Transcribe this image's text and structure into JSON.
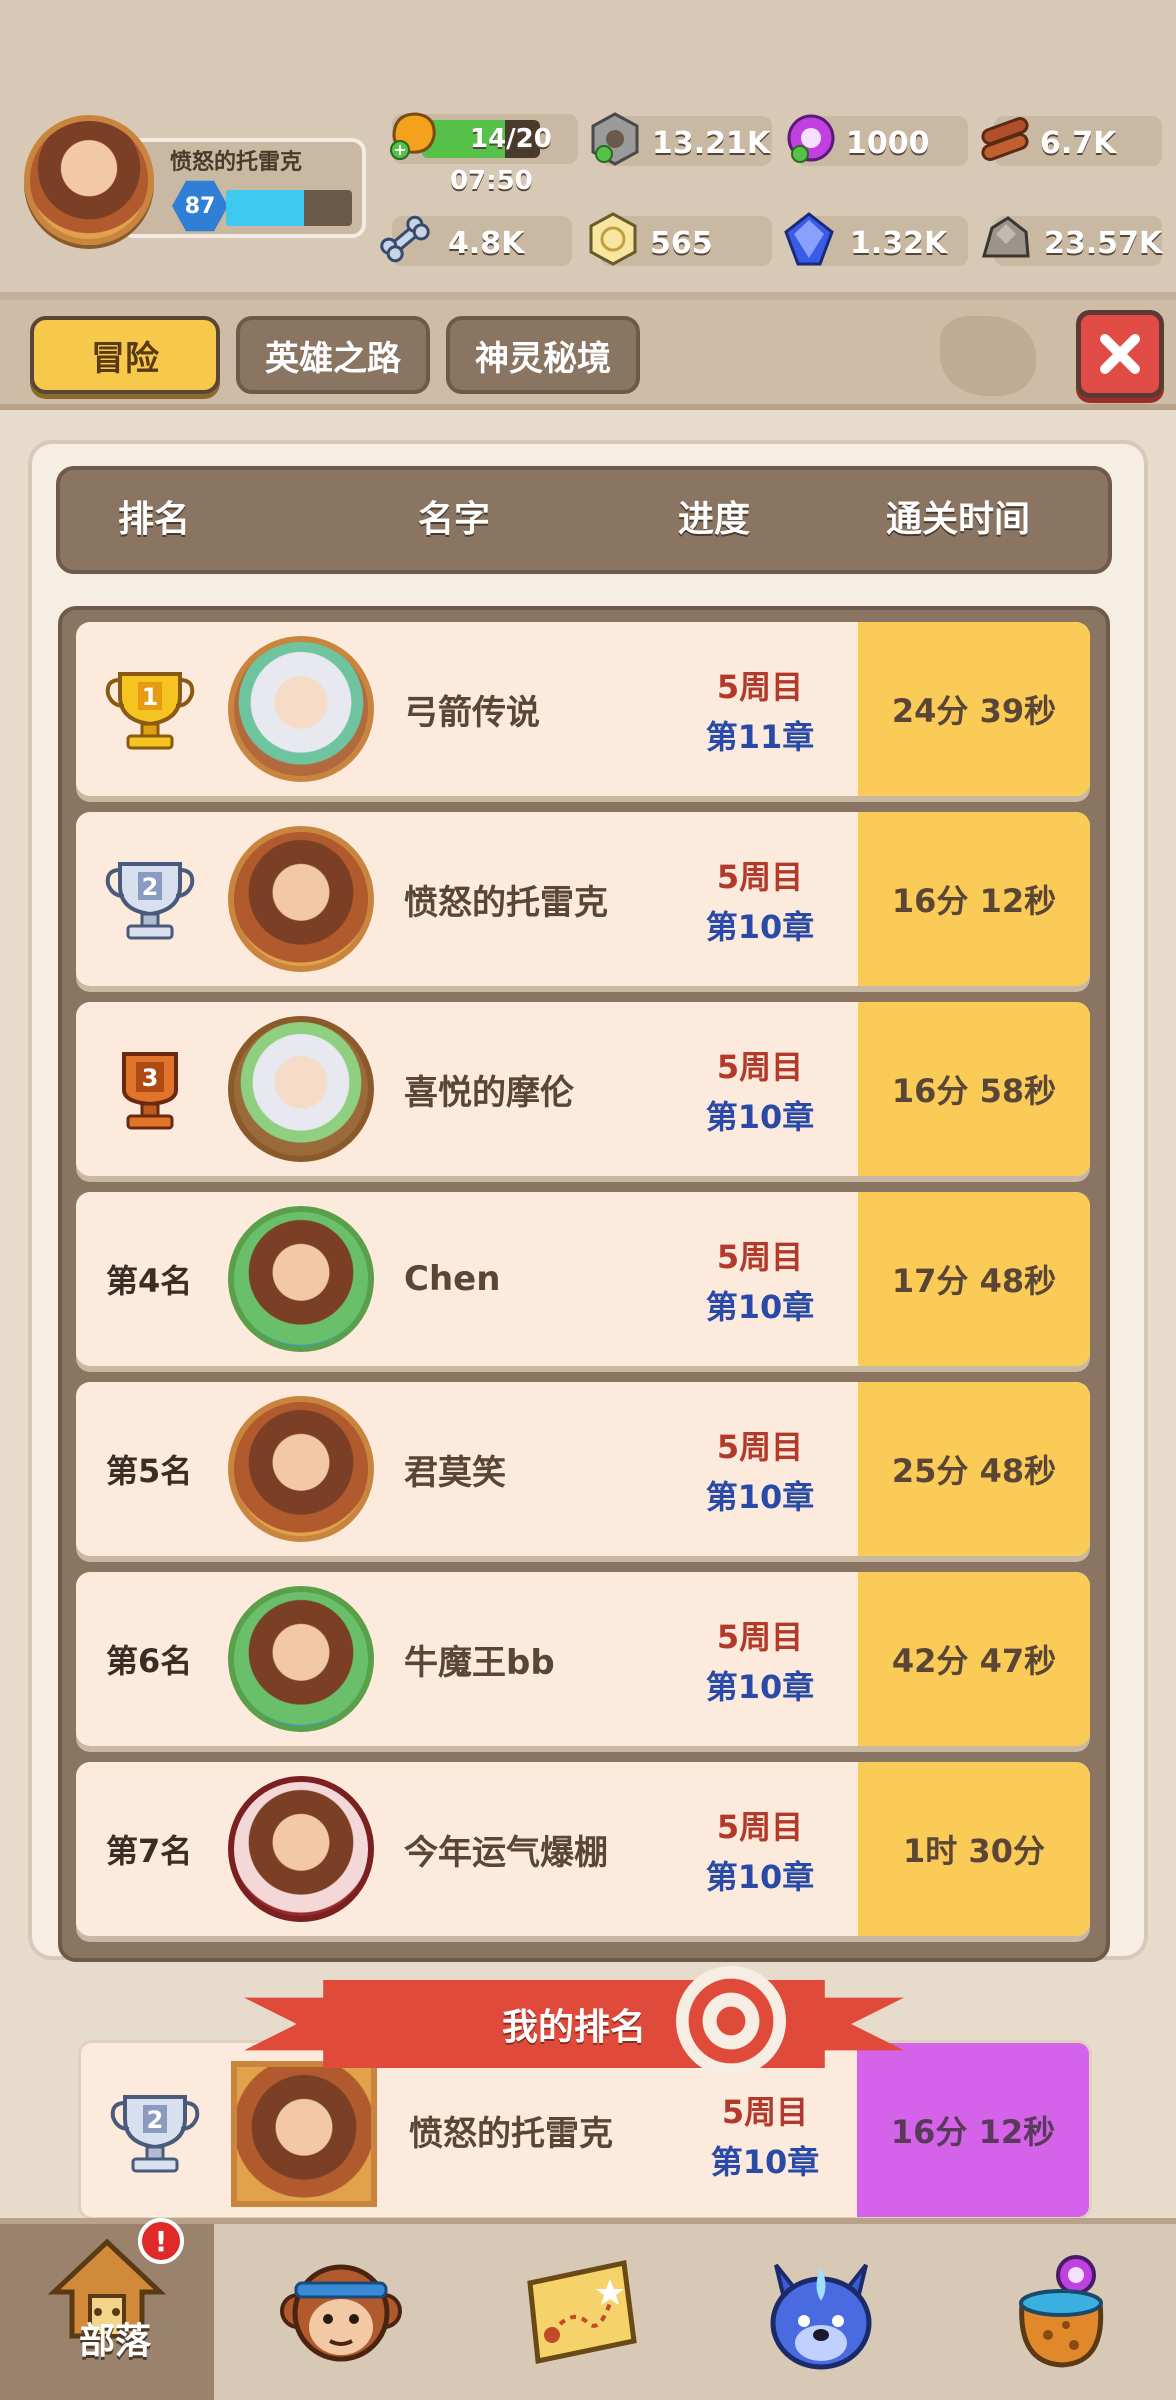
{
  "player": {
    "name": "愤怒的托雷克",
    "level": "87",
    "level_progress": 0.62
  },
  "resources": {
    "stamina": "14/20",
    "stamina_timer": "07:50",
    "nut": "13.21K",
    "gem_purple": "1000",
    "wood": "6.7K",
    "bone": "4.8K",
    "coin": "565",
    "crystal": "1.32K",
    "stone": "23.57K"
  },
  "tabs": [
    "冒险",
    "英雄之路",
    "神灵秘境"
  ],
  "columns": {
    "rank": "排名",
    "name": "名字",
    "progress": "进度",
    "time": "通关时间"
  },
  "rows": [
    {
      "rank": "1",
      "name": "弓箭传说",
      "cycle": "5周目",
      "chapter": "第11章",
      "time": "24分 39秒"
    },
    {
      "rank": "2",
      "name": "愤怒的托雷克",
      "cycle": "5周目",
      "chapter": "第10章",
      "time": "16分 12秒"
    },
    {
      "rank": "3",
      "name": "喜悦的摩伦",
      "cycle": "5周目",
      "chapter": "第10章",
      "time": "16分 58秒"
    },
    {
      "rank": "第4名",
      "name": "Chen",
      "cycle": "5周目",
      "chapter": "第10章",
      "time": "17分 48秒"
    },
    {
      "rank": "第5名",
      "name": "君莫笑",
      "cycle": "5周目",
      "chapter": "第10章",
      "time": "25分 48秒"
    },
    {
      "rank": "第6名",
      "name": "牛魔王bb",
      "cycle": "5周目",
      "chapter": "第10章",
      "time": "42分 47秒"
    },
    {
      "rank": "第7名",
      "name": "今年运气爆棚",
      "cycle": "5周目",
      "chapter": "第10章",
      "time": "1时 30分"
    }
  ],
  "my_rank": {
    "title": "我的排名",
    "rank": "2",
    "name": "愤怒的托雷克",
    "cycle": "5周目",
    "chapter": "第10章",
    "time": "16分 12秒"
  },
  "nav": {
    "tribe_label": "部落",
    "badge": "!"
  },
  "colors": {
    "gold": "#fbcb57",
    "my_time": "#d563ea",
    "cycle_red": "#b33a2a",
    "chapter_blue": "#2a4aa8"
  }
}
